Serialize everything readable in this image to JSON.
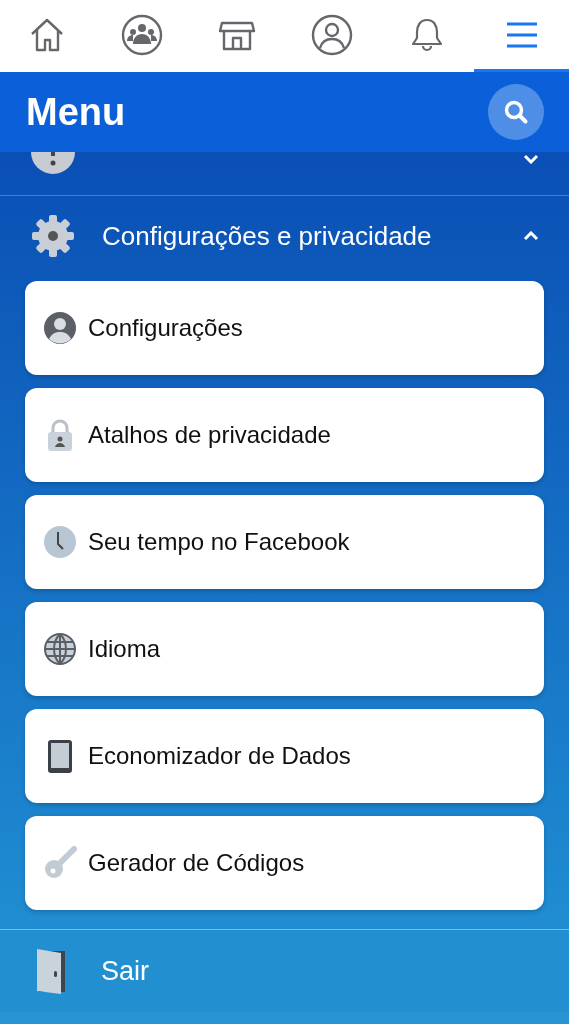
{
  "tabs": [
    {
      "selected": false
    },
    {
      "selected": false
    },
    {
      "selected": false
    },
    {
      "selected": false
    },
    {
      "selected": false
    },
    {
      "selected": true
    }
  ],
  "header": {
    "title": "Menu"
  },
  "sections": [
    {
      "expanded": false
    },
    {
      "label": "Configurações e privacidade",
      "expanded": true,
      "items": [
        {
          "label": "Configurações"
        },
        {
          "label": "Atalhos de privacidade"
        },
        {
          "label": "Seu tempo no Facebook"
        },
        {
          "label": "Idioma"
        },
        {
          "label": "Economizador de Dados"
        },
        {
          "label": "Gerador de Códigos"
        }
      ]
    }
  ],
  "logout": {
    "label": "Sair"
  }
}
